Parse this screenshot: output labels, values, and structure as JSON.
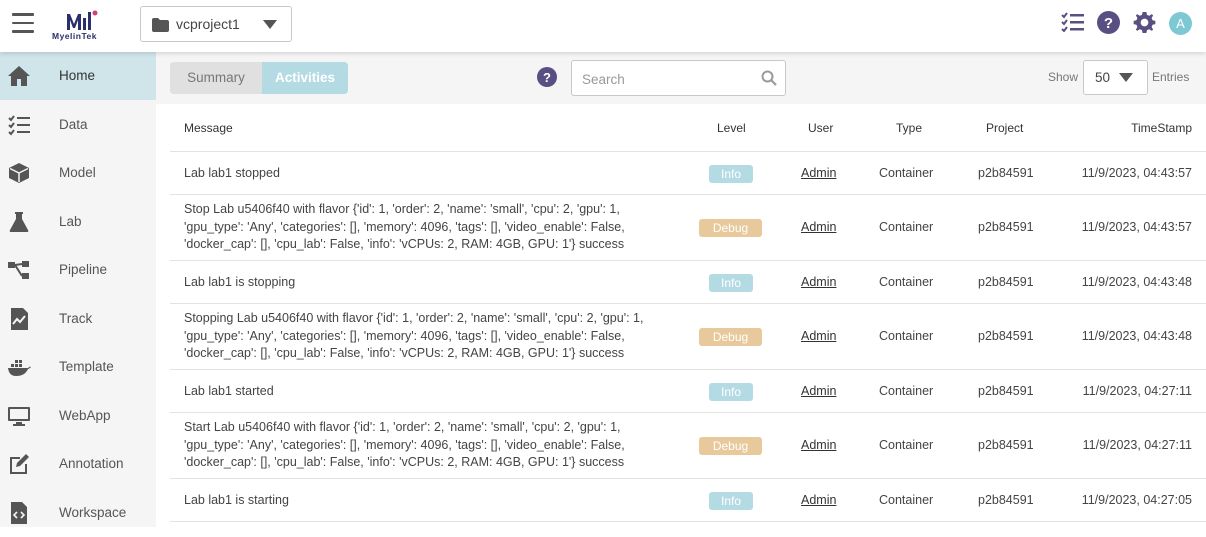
{
  "app": {
    "logo_text": "MyelinTek",
    "project_name": "vcproject1",
    "avatar_letter": "A",
    "accent": "#b4dae3",
    "debug_color": "#e8c99b",
    "icon_color": "#5a4f83"
  },
  "sidebar": {
    "items": [
      {
        "label": "Home",
        "icon": "home-icon"
      },
      {
        "label": "Data",
        "icon": "data-list-icon"
      },
      {
        "label": "Model",
        "icon": "cube-icon"
      },
      {
        "label": "Lab",
        "icon": "flask-icon"
      },
      {
        "label": "Pipeline",
        "icon": "pipeline-icon"
      },
      {
        "label": "Track",
        "icon": "track-chart-icon"
      },
      {
        "label": "Template",
        "icon": "docker-icon"
      },
      {
        "label": "WebApp",
        "icon": "monitor-icon"
      },
      {
        "label": "Annotation",
        "icon": "edit-icon"
      },
      {
        "label": "Workspace",
        "icon": "code-file-icon"
      }
    ]
  },
  "tabs": {
    "summary": "Summary",
    "activities": "Activities"
  },
  "search": {
    "placeholder": "Search",
    "value": ""
  },
  "paging": {
    "show_label": "Show",
    "page_size": "50",
    "entries_label": "Entries"
  },
  "table": {
    "headers": {
      "message": "Message",
      "level": "Level",
      "user": "User",
      "type": "Type",
      "project": "Project",
      "timestamp": "TimeStamp"
    },
    "rows": [
      {
        "message": [
          "Lab lab1 stopped"
        ],
        "level": "Info",
        "user": "Admin",
        "type": "Container",
        "project": "p2b84591",
        "timestamp": "11/9/2023, 04:43:57"
      },
      {
        "message": [
          "Stop Lab u5406f40 with flavor {'id': 1, 'order': 2, 'name': 'small', 'cpu': 2, 'gpu': 1,",
          "'gpu_type': 'Any', 'categories': [], 'memory': 4096, 'tags': [], 'video_enable': False,",
          "'docker_cap': [], 'cpu_lab': False, 'info': 'vCPUs: 2, RAM: 4GB, GPU: 1'} success"
        ],
        "level": "Debug",
        "user": "Admin",
        "type": "Container",
        "project": "p2b84591",
        "timestamp": "11/9/2023, 04:43:57"
      },
      {
        "message": [
          "Lab lab1 is stopping"
        ],
        "level": "Info",
        "user": "Admin",
        "type": "Container",
        "project": "p2b84591",
        "timestamp": "11/9/2023, 04:43:48"
      },
      {
        "message": [
          "Stopping Lab u5406f40 with flavor {'id': 1, 'order': 2, 'name': 'small', 'cpu': 2, 'gpu': 1,",
          "'gpu_type': 'Any', 'categories': [], 'memory': 4096, 'tags': [], 'video_enable': False,",
          "'docker_cap': [], 'cpu_lab': False, 'info': 'vCPUs: 2, RAM: 4GB, GPU: 1'} success"
        ],
        "level": "Debug",
        "user": "Admin",
        "type": "Container",
        "project": "p2b84591",
        "timestamp": "11/9/2023, 04:43:48"
      },
      {
        "message": [
          "Lab lab1 started"
        ],
        "level": "Info",
        "user": "Admin",
        "type": "Container",
        "project": "p2b84591",
        "timestamp": "11/9/2023, 04:27:11"
      },
      {
        "message": [
          "Start Lab u5406f40 with flavor {'id': 1, 'order': 2, 'name': 'small', 'cpu': 2, 'gpu': 1,",
          "'gpu_type': 'Any', 'categories': [], 'memory': 4096, 'tags': [], 'video_enable': False,",
          "'docker_cap': [], 'cpu_lab': False, 'info': 'vCPUs: 2, RAM: 4GB, GPU: 1'} success"
        ],
        "level": "Debug",
        "user": "Admin",
        "type": "Container",
        "project": "p2b84591",
        "timestamp": "11/9/2023, 04:27:11"
      },
      {
        "message": [
          "Lab lab1 is starting"
        ],
        "level": "Info",
        "user": "Admin",
        "type": "Container",
        "project": "p2b84591",
        "timestamp": "11/9/2023, 04:27:05"
      }
    ]
  }
}
